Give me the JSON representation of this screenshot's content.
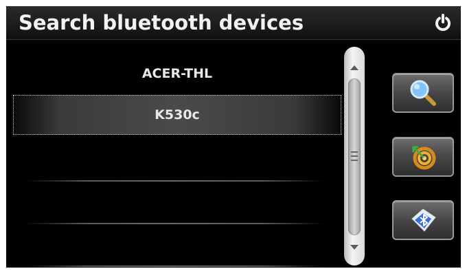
{
  "window": {
    "title": "Search bluetooth devices"
  },
  "devices": [
    {
      "name": "ACER-THL",
      "selected": false
    },
    {
      "name": "K530c",
      "selected": true
    }
  ],
  "toolbar": {
    "buttons": [
      {
        "icon": "magnifier-search-icon"
      },
      {
        "icon": "pair-connect-icon"
      },
      {
        "icon": "bluetooth-settings-icon"
      }
    ]
  },
  "icons": {
    "power": "power-icon"
  },
  "colors": {
    "background": "#000000",
    "text": "#e8e8e8",
    "selected_row": "#4a4a4a"
  }
}
